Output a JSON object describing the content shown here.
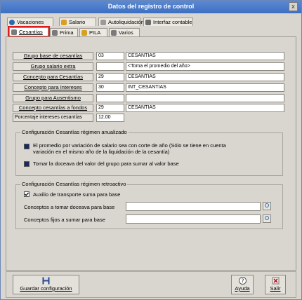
{
  "window": {
    "title": "Datos del registro de control",
    "close_label": "x"
  },
  "tabs_row1": [
    {
      "label": "Vacaciones",
      "color": "#2a6bb0"
    },
    {
      "label": "Salario",
      "color": "#d8a020"
    },
    {
      "label": "Autoliquidación",
      "color": "#8a8a8a"
    },
    {
      "label": "Interfaz contable",
      "color": "#6a6a6a"
    }
  ],
  "tabs_row2": [
    {
      "label": "Cesantías",
      "color": "#7a7a7a",
      "selected": true
    },
    {
      "label": "Prima",
      "color": "#7a7a7a"
    },
    {
      "label": "PILA",
      "color": "#d8a020"
    },
    {
      "label": "Varios",
      "color": "#7a7a7a"
    }
  ],
  "rows": [
    {
      "button": "Grupo base de cesantías",
      "code": "03",
      "desc": "CESANTIAS"
    },
    {
      "button": "Grupo salario extra",
      "code": "",
      "desc": "<Toma el promedio del año>"
    },
    {
      "button": "Concepto para Cesantías",
      "code": "29",
      "desc": "CESANTIAS"
    },
    {
      "button": "Concepto para Intereses",
      "code": "30",
      "desc": "INT_CESANTIAS"
    },
    {
      "button": "Grupo para Ausentismo",
      "code": "",
      "desc": ""
    },
    {
      "button": "Concepto cesantías a fondos",
      "code": "29",
      "desc": "CESANTIAS"
    }
  ],
  "interest": {
    "label": "Porcentaje intereses cesantías",
    "value": "12.00"
  },
  "group_annual": {
    "title": "Configuración Cesantías régimen anualizado",
    "opt1_line1": "El promedio por variación de salario sea con corte de año (Sólo se tiene en cuenta",
    "opt1_line2": "variación en el mismo año de la liquidación de la cesantía)",
    "opt2": "Tomar la doceava del valor del grupo para sumar al valor base"
  },
  "group_retro": {
    "title": "Configuración Cesantías régimen retroactivo",
    "check": "Auxilio de transporte suma para base",
    "field1_label": "Conceptos a tomar doceava para base",
    "field1_value": "",
    "field2_label": "Conceptos fijos a sumar para base",
    "field2_value": ""
  },
  "buttons": {
    "save": "Guardar configuración",
    "help": "Ayuda",
    "exit": "Salir"
  }
}
